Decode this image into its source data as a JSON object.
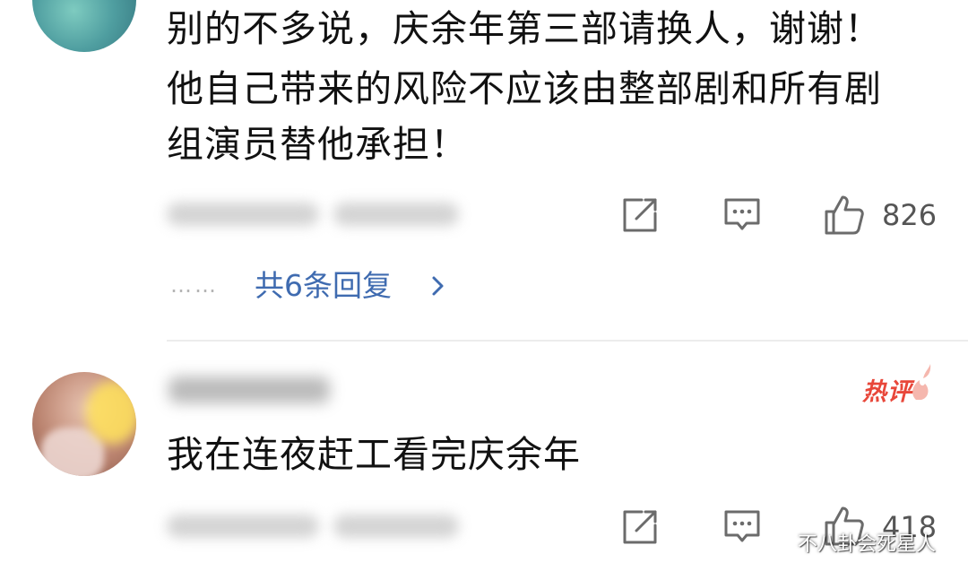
{
  "comments": [
    {
      "text_lines": [
        "别的不多说，庆余年第三部请换人，谢谢！",
        "他自己带来的风险不应该由整部剧和所有剧",
        "组演员替他承担！"
      ],
      "like_count": "826",
      "replies_label": "共6条回复",
      "dots": "……"
    },
    {
      "text": "我在连夜赶工看完庆余年",
      "badge": "热评",
      "like_count": "418"
    }
  ],
  "icons": {
    "share": "share-icon",
    "comment": "comment-icon",
    "like": "thumbs-up-icon",
    "chevron": "chevron-right-icon"
  },
  "colors": {
    "link": "#3f6bb0",
    "hot_badge": "#e8473a",
    "meta": "#555555"
  },
  "watermark": "不八卦会死星人"
}
